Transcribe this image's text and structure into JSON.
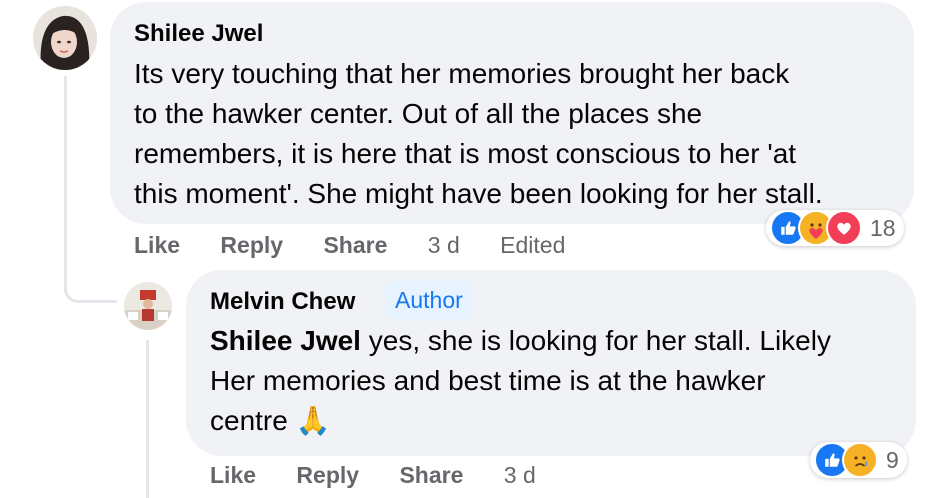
{
  "comment": {
    "author": "Shilee Jwel",
    "text": "Its very touching that her memories brought her back\nto the hawker center. Out of all the places she\nremembers, it is here that is most conscious to her 'at\nthis moment'. She might have been looking for her stall.",
    "reaction_count": "18",
    "reactions": [
      "like-icon",
      "care-icon",
      "love-icon"
    ],
    "actions": {
      "like": "Like",
      "reply": "Reply",
      "share": "Share",
      "time": "3 d",
      "edited": "Edited"
    }
  },
  "reply": {
    "author": "Melvin Chew",
    "badge": "Author",
    "mention": "Shilee Jwel",
    "text": " yes, she is looking for her stall. Likely\nHer memories and best time is at the hawker\ncentre ",
    "emoji": "🙏",
    "reaction_count": "9",
    "reactions": [
      "like-icon",
      "sad-icon"
    ],
    "actions": {
      "like": "Like",
      "reply": "Reply",
      "share": "Share",
      "time": "3 d"
    }
  },
  "colors": {
    "bubble": "#f0f2f5",
    "like_blue": "#1877f2",
    "love_red": "#f33e58",
    "emoji_yellow": "#f7b125",
    "meta_gray": "#65676b"
  }
}
